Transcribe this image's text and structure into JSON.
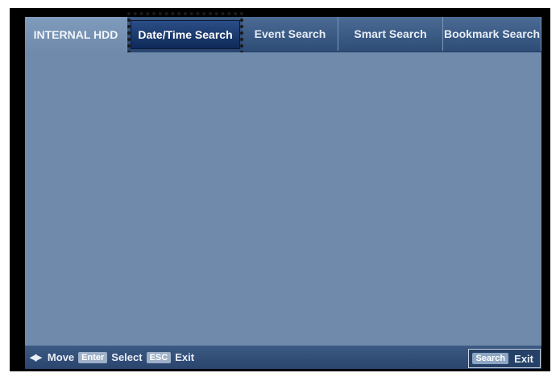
{
  "tabs": {
    "source": "INTERNAL HDD",
    "items": [
      "Date/Time Search",
      "Event Search",
      "Smart Search",
      "Bookmark Search"
    ],
    "selected": "Date/Time Search"
  },
  "footer": {
    "move_label": "Move",
    "enter_key": "Enter",
    "select_label": "Select",
    "esc_key": "ESC",
    "exit_label": "Exit",
    "search_key": "Search",
    "search_exit_label": "Exit"
  },
  "icons": {
    "move": "left-right-arrows-icon"
  },
  "colors": {
    "panel": "#6f8aaa",
    "bar": "#2e4d77",
    "selected_tab": "#1a3768"
  }
}
